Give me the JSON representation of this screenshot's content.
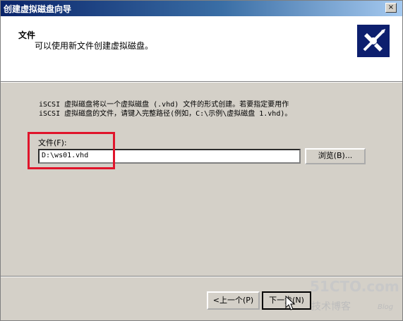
{
  "window": {
    "title": "创建虚拟磁盘向导",
    "close_label": "×"
  },
  "header": {
    "title": "文件",
    "subtitle": "可以使用新文件创建虚拟磁盘。"
  },
  "body": {
    "description_line1": "iSCSI 虚拟磁盘将以一个虚拟磁盘 (.vhd) 文件的形式创建。若要指定要用作",
    "description_line2": "iSCSI 虚拟磁盘的文件，请键入完整路径(例如，C:\\示例\\虚拟磁盘 1.vhd)。",
    "file_label": "文件(F):",
    "file_value": "D:\\ws01.vhd",
    "browse_label": "浏览(B)..."
  },
  "footer": {
    "prev_label": "<上一个(P)",
    "next_label": "下一步(N)"
  },
  "watermark": {
    "main": "51CTO.com",
    "sub": "技术博客",
    "blog": "Blog"
  },
  "colors": {
    "highlight": "#e0142b",
    "titlebar": "#0a246a"
  }
}
